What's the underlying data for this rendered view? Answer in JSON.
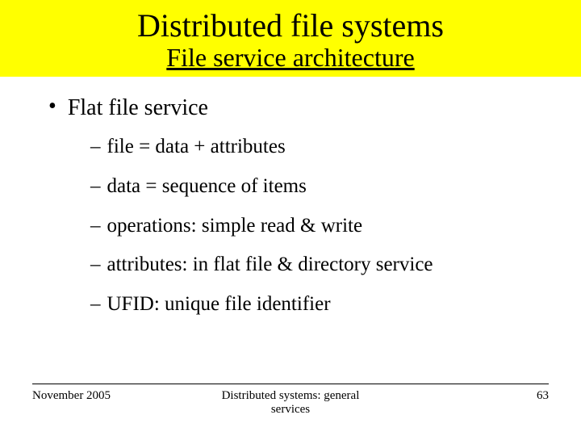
{
  "title": "Distributed file systems",
  "subtitle": "File service architecture",
  "bullet": "Flat file service",
  "dashes": [
    "file = data + attributes",
    "data = sequence of items",
    "operations: simple read & write",
    "attributes: in flat file & directory service",
    "UFID: unique file identifier"
  ],
  "footer": {
    "left": "November 2005",
    "center": "Distributed systems: general services",
    "right": "63"
  }
}
